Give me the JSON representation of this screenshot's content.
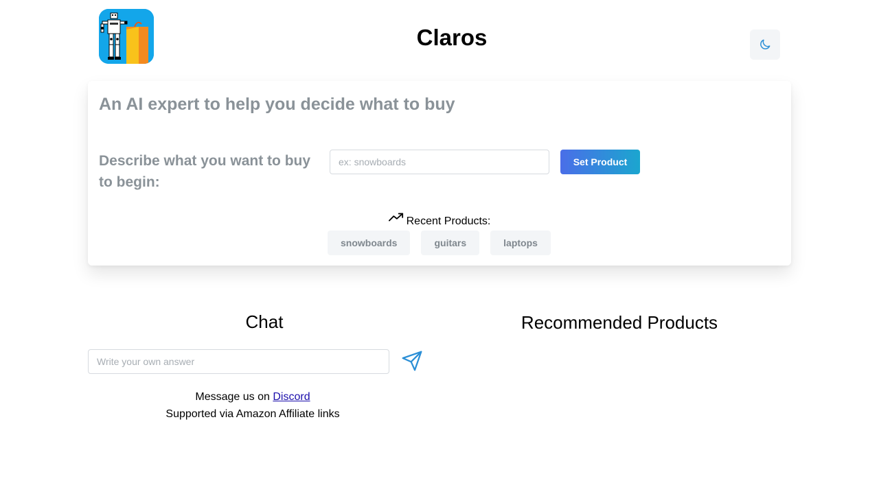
{
  "header": {
    "title": "Claros",
    "logo_icon": "robot-shopping-icon",
    "theme_toggle_icon": "moon-icon"
  },
  "intro": {
    "tagline": "An AI expert to help you decide what to buy",
    "describe_label": "Describe what you want to buy to begin:",
    "product_input": {
      "value": "",
      "placeholder": "ex: snowboards"
    },
    "set_button_label": "Set Product"
  },
  "recent": {
    "icon": "trending-up-icon",
    "label": "Recent Products:",
    "items": [
      "snowboards",
      "guitars",
      "laptops"
    ]
  },
  "chat": {
    "title": "Chat",
    "answer_input": {
      "value": "",
      "placeholder": "Write your own answer"
    },
    "send_icon": "send-icon"
  },
  "recommended": {
    "title": "Recommended Products"
  },
  "footer": {
    "message_prefix": "Message us on ",
    "discord_link": "Discord",
    "affiliate_note": "Supported via Amazon Affiliate links"
  },
  "colors": {
    "accent_gradient_start": "#4a6ee8",
    "accent_gradient_end": "#1ba6cf",
    "muted_text": "#8a9298",
    "send_icon": "#2b8fd6",
    "logo_bg": "#13a6ea"
  }
}
